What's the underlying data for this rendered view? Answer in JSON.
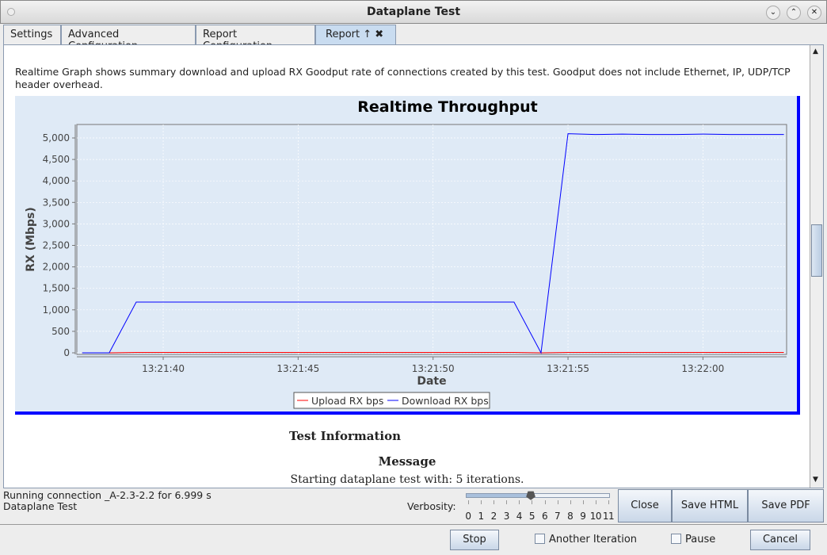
{
  "window": {
    "title": "Dataplane Test"
  },
  "tabs": [
    {
      "label": "Settings"
    },
    {
      "label": "Advanced Configuration"
    },
    {
      "label": "Report Configuration"
    },
    {
      "label": "Report  ↑  ✖"
    }
  ],
  "description": "Realtime Graph shows summary download and upload RX Goodput rate of connections created by this test. Goodput does not include Ethernet, IP, UDP/TCP header overhead.",
  "chart_data": {
    "type": "line",
    "title": "Realtime Throughput",
    "xlabel": "Date",
    "ylabel": "RX (Mbps)",
    "ylim": [
      0,
      5300
    ],
    "yticks": [
      "0",
      "500",
      "1,000",
      "1,500",
      "2,000",
      "2,500",
      "3,000",
      "3,500",
      "4,000",
      "4,500",
      "5,000"
    ],
    "xlim": [
      "13:21:36.8",
      "13:22:03.1"
    ],
    "xticks": [
      "13:21:40",
      "13:21:45",
      "13:21:50",
      "13:21:55",
      "13:22:00"
    ],
    "grid": true,
    "legend": "bottom",
    "x": [
      "13:21:37",
      "13:21:38",
      "13:21:39",
      "13:21:40",
      "13:21:41",
      "13:21:42",
      "13:21:43",
      "13:21:44",
      "13:21:45",
      "13:21:46",
      "13:21:47",
      "13:21:48",
      "13:21:49",
      "13:21:50",
      "13:21:51",
      "13:21:52",
      "13:21:53",
      "13:21:54",
      "13:21:55",
      "13:21:56",
      "13:21:57",
      "13:21:58",
      "13:21:59",
      "13:22:00",
      "13:22:01",
      "13:22:02",
      "13:22:03"
    ],
    "series": [
      {
        "name": "Upload RX bps",
        "color": "#ff0000",
        "values": [
          0,
          0,
          10,
          10,
          10,
          10,
          10,
          10,
          10,
          10,
          10,
          10,
          10,
          10,
          10,
          10,
          10,
          0,
          10,
          10,
          10,
          10,
          10,
          10,
          10,
          10,
          10
        ]
      },
      {
        "name": "Download RX bps",
        "color": "#0000ff",
        "values": [
          0,
          0,
          1180,
          1180,
          1180,
          1180,
          1180,
          1180,
          1180,
          1180,
          1180,
          1180,
          1180,
          1180,
          1180,
          1180,
          1180,
          0,
          5100,
          5080,
          5090,
          5080,
          5080,
          5090,
          5080,
          5080,
          5080
        ]
      }
    ]
  },
  "info": {
    "heading": "Test Information",
    "message_label": "Message",
    "message": "Starting dataplane test with: 5 iterations."
  },
  "status": {
    "line1": "Running connection _A-2.3-2.2 for 6.999 s",
    "line2": "Dataplane Test"
  },
  "verbosity": {
    "label": "Verbosity:",
    "value": 5,
    "ticks": [
      "0",
      "1",
      "2",
      "3",
      "4",
      "5",
      "6",
      "7",
      "8",
      "9",
      "10",
      "11"
    ]
  },
  "buttons": {
    "close": "Close",
    "save_html": "Save HTML",
    "save_pdf": "Save PDF",
    "stop": "Stop",
    "cancel": "Cancel"
  },
  "checkboxes": {
    "another": "Another Iteration",
    "pause": "Pause"
  }
}
